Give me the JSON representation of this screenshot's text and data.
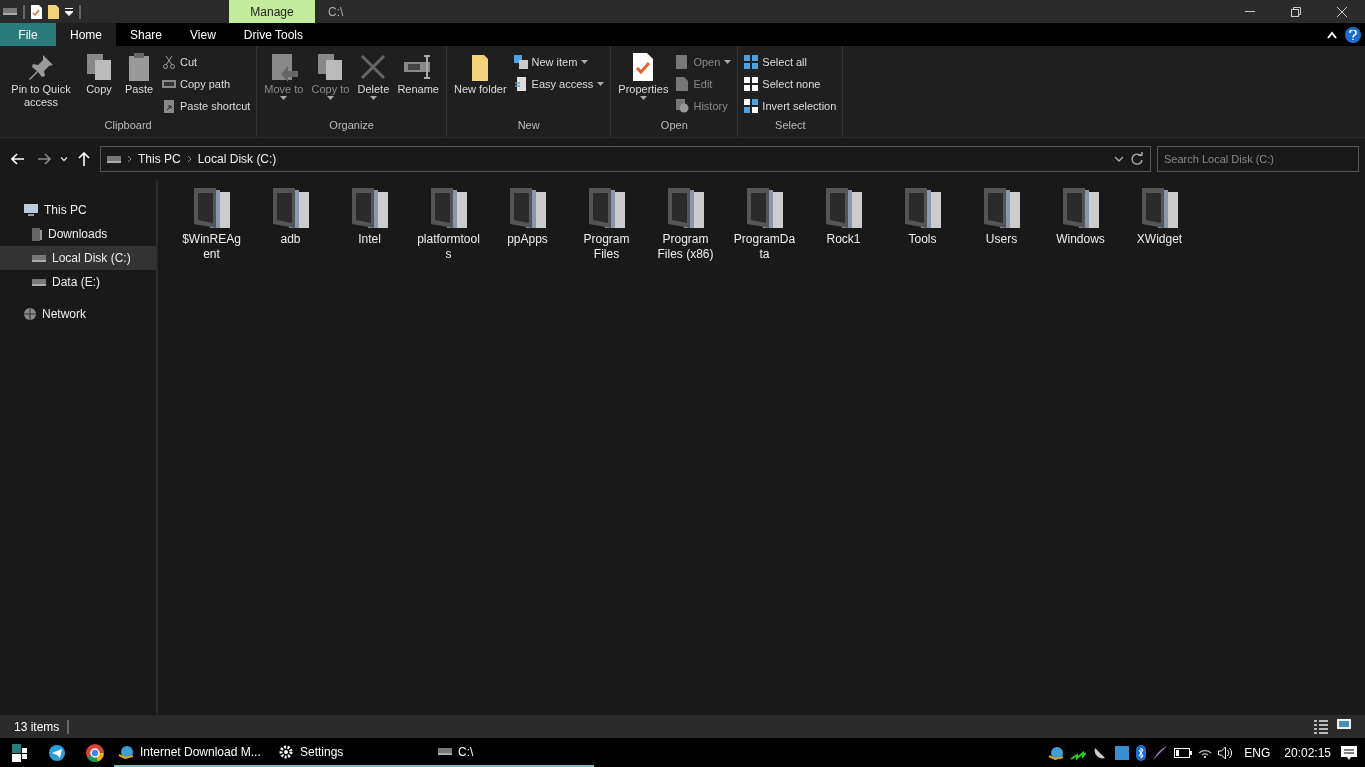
{
  "title_bar": {
    "contextual_tab": "Manage",
    "title": "C:\\"
  },
  "ribbon_tabs": [
    {
      "label": "File",
      "kind": "file",
      "selected": false
    },
    {
      "label": "Home",
      "kind": "tab",
      "selected": true
    },
    {
      "label": "Share",
      "kind": "tab",
      "selected": false
    },
    {
      "label": "View",
      "kind": "tab",
      "selected": false
    },
    {
      "label": "Drive Tools",
      "kind": "tab",
      "selected": false
    }
  ],
  "ribbon_groups": [
    {
      "name": "Clipboard",
      "buttons": [
        {
          "kind": "large",
          "label": "Pin to Quick access",
          "disabled": false,
          "dropdown": false
        },
        {
          "kind": "large",
          "label": "Copy",
          "disabled": false,
          "dropdown": false
        },
        {
          "kind": "large",
          "label": "Paste",
          "disabled": false,
          "dropdown": false
        },
        {
          "kind": "stack",
          "items": [
            {
              "label": "Cut",
              "disabled": false,
              "dropdown": false
            },
            {
              "label": "Copy path",
              "disabled": false,
              "dropdown": false
            },
            {
              "label": "Paste shortcut",
              "disabled": false,
              "dropdown": false
            }
          ]
        }
      ]
    },
    {
      "name": "Organize",
      "buttons": [
        {
          "kind": "large",
          "label": "Move to",
          "disabled": true,
          "dropdown": true
        },
        {
          "kind": "large",
          "label": "Copy to",
          "disabled": true,
          "dropdown": true
        },
        {
          "kind": "large",
          "label": "Delete",
          "disabled": false,
          "dropdown": true
        },
        {
          "kind": "large",
          "label": "Rename",
          "disabled": false,
          "dropdown": false
        }
      ]
    },
    {
      "name": "New",
      "buttons": [
        {
          "kind": "large",
          "label": "New folder",
          "disabled": false,
          "dropdown": false
        },
        {
          "kind": "stack",
          "items": [
            {
              "label": "New item",
              "disabled": false,
              "dropdown": true
            },
            {
              "label": "Easy access",
              "disabled": false,
              "dropdown": true
            }
          ]
        }
      ]
    },
    {
      "name": "Open",
      "buttons": [
        {
          "kind": "large",
          "label": "Properties",
          "disabled": false,
          "dropdown": true
        },
        {
          "kind": "stack",
          "items": [
            {
              "label": "Open",
              "disabled": true,
              "dropdown": true
            },
            {
              "label": "Edit",
              "disabled": true,
              "dropdown": false
            },
            {
              "label": "History",
              "disabled": true,
              "dropdown": false
            }
          ]
        }
      ]
    },
    {
      "name": "Select",
      "buttons": [
        {
          "kind": "stack",
          "items": [
            {
              "label": "Select all",
              "disabled": false,
              "dropdown": false
            },
            {
              "label": "Select none",
              "disabled": false,
              "dropdown": false
            },
            {
              "label": "Invert selection",
              "disabled": false,
              "dropdown": false
            }
          ]
        }
      ]
    }
  ],
  "address_bar": {
    "breadcrumbs": [
      "This PC",
      "Local Disk (C:)"
    ]
  },
  "search": {
    "placeholder": "Search Local Disk (C:)"
  },
  "sidebar": {
    "items": [
      {
        "label": "This PC",
        "selected": false,
        "children": [
          {
            "label": "Downloads",
            "selected": false
          },
          {
            "label": "Local Disk (C:)",
            "selected": true
          },
          {
            "label": "Data (E:)",
            "selected": false
          }
        ]
      },
      {
        "label": "Network",
        "selected": false
      }
    ]
  },
  "files": [
    {
      "name": "$WinREAgent"
    },
    {
      "name": "adb"
    },
    {
      "name": "Intel"
    },
    {
      "name": "platformtools"
    },
    {
      "name": "ppApps"
    },
    {
      "name": "Program Files"
    },
    {
      "name": "Program Files (x86)"
    },
    {
      "name": "ProgramData"
    },
    {
      "name": "Rock1"
    },
    {
      "name": "Tools"
    },
    {
      "name": "Users"
    },
    {
      "name": "Windows"
    },
    {
      "name": "XWidget"
    }
  ],
  "status_bar": {
    "item_count": "13 items"
  },
  "taskbar": {
    "apps": [
      {
        "label": "Internet Download M..."
      },
      {
        "label": "Settings"
      },
      {
        "label": "C:\\"
      }
    ],
    "language": "ENG",
    "time": "20:02:15"
  }
}
